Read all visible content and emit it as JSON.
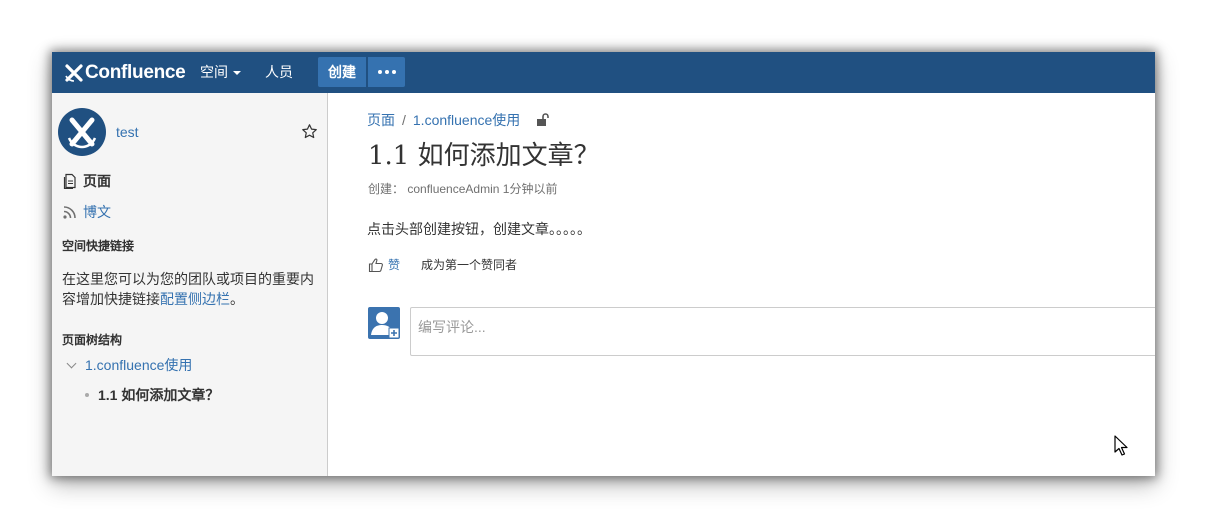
{
  "header": {
    "logo_text": "Confluence",
    "nav": {
      "spaces_label": "空间",
      "people_label": "人员"
    },
    "create_label": "创建",
    "more_icon": "more-dots-icon",
    "colors": {
      "bar": "#205081",
      "button": "#3572b0"
    }
  },
  "sidebar": {
    "space_name": "test",
    "star_icon": "star-outline-icon",
    "links": [
      {
        "label": "页面",
        "icon": "pages-icon"
      },
      {
        "label": "博文",
        "icon": "rss-icon"
      }
    ],
    "shortcuts_heading": "空间快捷链接",
    "shortcuts_text": "在这里您可以为您的团队或项目的重要内容增加快捷链接",
    "shortcuts_link": "配置侧边栏",
    "shortcuts_end": "。",
    "tree_heading": "页面树结构",
    "tree": [
      {
        "label": "1.confluence使用"
      },
      {
        "label": "1.1 如何添加文章？"
      }
    ]
  },
  "main": {
    "breadcrumb": {
      "root": "页面",
      "separator": "/",
      "parent": "1.confluence使用"
    },
    "title": "1.1 如何添加文章？",
    "meta": {
      "prefix": "创建：",
      "author": "confluenceAdmin",
      "time": "1分钟以前"
    },
    "body": "点击头部创建按钮，创建文章。。。。。",
    "like": {
      "label": "赞",
      "note": "成为第一个赞同者"
    },
    "comment_placeholder": "编写评论..."
  }
}
